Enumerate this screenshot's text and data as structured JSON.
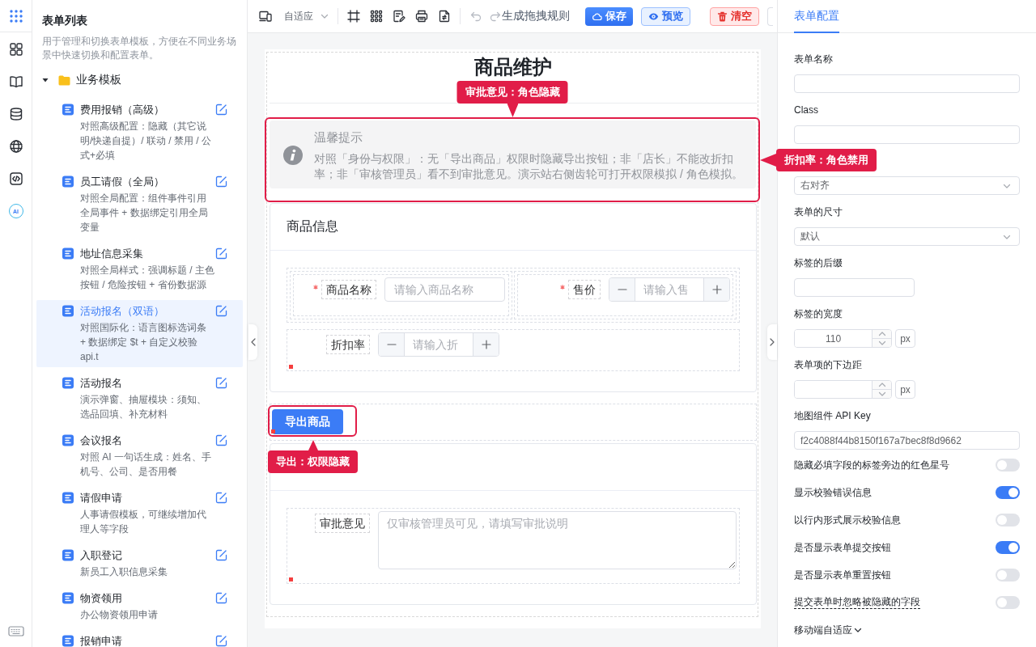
{
  "rail": {
    "assistant_label": "AI"
  },
  "sidebar": {
    "title": "表单列表",
    "description": "用于管理和切换表单模板，方便在不同业务场景中快速切换和配置表单。",
    "tree": [
      {
        "label": "业务模板",
        "expanded": true,
        "children": [
          {
            "title": "费用报销（高级）",
            "description": "对照高级配置：隐藏（其它说明/快递自提）/ 联动 / 禁用 / 公式+必填",
            "selected": false
          },
          {
            "title": "员工请假（全局）",
            "description": "对照全局配置：组件事件引用全局事件 + 数据绑定引用全局变量",
            "selected": false
          },
          {
            "title": "地址信息采集",
            "description": "对照全局样式：强调标题 / 主色按钮 / 危险按钮 + 省份数据源",
            "selected": false
          },
          {
            "title": "活动报名（双语）",
            "description": "对照国际化：语言图标选词条 + 数据绑定 $t + 自定义校验 api.t",
            "selected": true
          },
          {
            "title": "活动报名",
            "description": "演示弹窗、抽屉模块：须知、选品回填、补充材料",
            "selected": false
          },
          {
            "title": "会议报名",
            "description": "对照 AI 一句话生成：姓名、手机号、公司、是否用餐",
            "selected": false
          },
          {
            "title": "请假申请",
            "description": "人事请假模板，可继续增加代理人等字段",
            "selected": false
          },
          {
            "title": "入职登记",
            "description": "新员工入职信息采集",
            "selected": false
          },
          {
            "title": "物资领用",
            "description": "办公物资领用申请",
            "selected": false
          },
          {
            "title": "报销申请",
            "selected": false
          }
        ]
      }
    ]
  },
  "toolbar": {
    "device_mode": "自适应",
    "history": [
      {
        "kind": "undo",
        "disabled": true
      },
      {
        "kind": "redo",
        "disabled": true
      }
    ],
    "generate_rules": "生成拖拽规则",
    "buttons": [
      {
        "kind": "primary",
        "label": "保存"
      },
      {
        "kind": "info",
        "label": "预览"
      },
      {
        "kind": "danger",
        "label": "清空"
      },
      {
        "kind": "default"
      }
    ]
  },
  "canvas": {
    "title": "商品维护",
    "components": [
      {
        "kind": "alert",
        "title": "温馨提示",
        "text": "对照「身份与权限」：无「导出商品」权限时隐藏导出按钮；非「店长」不能改折扣率；非「审核管理员」看不到审批意见。演示站右侧齿轮可打开权限模拟 / 角色模拟。",
        "highlighted": true,
        "has_rule": false,
        "callouts": [
          {
            "kind": "top",
            "text": "审批意见：角色隐藏"
          },
          {
            "kind": "right",
            "text": "折扣率：角色禁用"
          }
        ]
      },
      {
        "kind": "card",
        "title": "商品信息",
        "rows": [
          {
            "kind": "grid",
            "items": [
              {
                "kind": "input",
                "label": "商品名称",
                "required": true,
                "placeholder": "请输入商品名称",
                "has_rule": false
              },
              {
                "kind": "number",
                "label": "售价",
                "required": true,
                "placeholder": "请输入售",
                "has_rule": false
              }
            ]
          },
          {
            "kind": "single",
            "items": [
              {
                "kind": "number",
                "label": "折扣率",
                "required": false,
                "placeholder": "请输入折",
                "has_rule": true
              }
            ]
          }
        ]
      },
      {
        "kind": "button",
        "label": "导出商品",
        "highlighted": true,
        "has_rule": true,
        "callouts": [
          {
            "kind": "bottom",
            "text": "导出：权限隐藏"
          }
        ]
      },
      {
        "kind": "card",
        "rows": [
          {
            "kind": "single",
            "items": [
              {
                "kind": "textarea",
                "label": "审批意见",
                "required": false,
                "placeholder": "仅审核管理员可见，请填写审批说明",
                "has_rule": true
              }
            ]
          }
        ]
      }
    ]
  },
  "config_panel": {
    "tabs": [
      {
        "label": "表单配置",
        "selected": true
      }
    ],
    "fields": [
      {
        "kind": "text",
        "label": "表单名称"
      },
      {
        "kind": "text",
        "label": "Class"
      },
      {
        "kind": "select",
        "value": "右对齐"
      },
      {
        "kind": "select",
        "label": "表单的尺寸",
        "value": "默认"
      },
      {
        "kind": "short-text",
        "label": "标签的后缀"
      },
      {
        "kind": "number",
        "label": "标签的宽度",
        "value": "110",
        "unit": "px"
      },
      {
        "kind": "number",
        "label": "表单项的下边距",
        "unit": "px"
      },
      {
        "kind": "text",
        "label": "地图组件 API Key",
        "value": "f2c4088f44b8150f167a7bec8f8d9662"
      },
      {
        "kind": "switch",
        "label": "隐藏必填字段的标签旁边的红色星号",
        "on": false,
        "has_tooltip": false
      },
      {
        "kind": "switch",
        "label": "显示校验错误信息",
        "on": true,
        "has_tooltip": false
      },
      {
        "kind": "switch",
        "label": "以行内形式展示校验信息",
        "on": false,
        "has_tooltip": false
      },
      {
        "kind": "switch",
        "label": "是否显示表单提交按钮",
        "on": true,
        "has_tooltip": false
      },
      {
        "kind": "switch",
        "label": "是否显示表单重置按钮",
        "on": false,
        "has_tooltip": false
      },
      {
        "kind": "switch",
        "label": "提交表单时忽略被隐藏的字段",
        "on": false,
        "has_tooltip": true
      },
      {
        "kind": "collapse",
        "label": "移动端自适应",
        "expanded": false
      }
    ]
  }
}
